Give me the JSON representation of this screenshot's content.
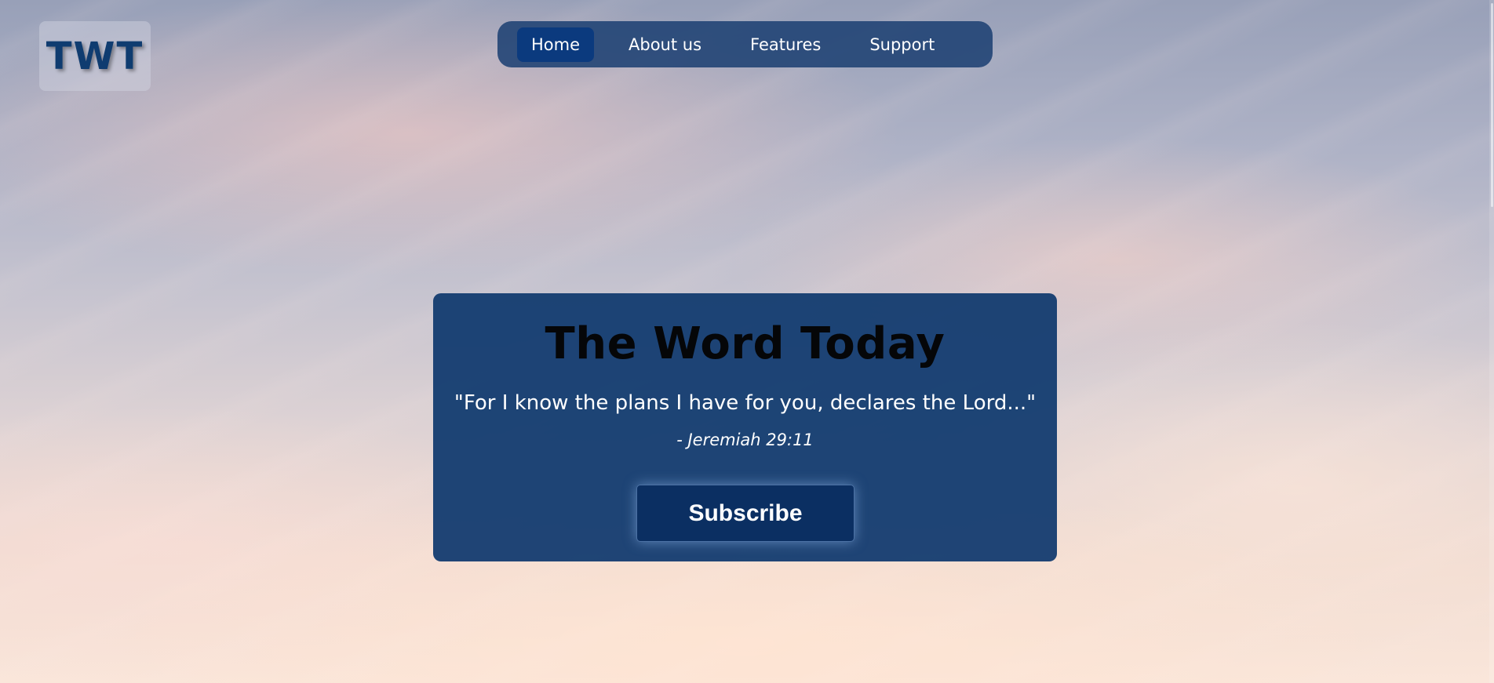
{
  "logo": {
    "text": "TWT"
  },
  "nav": {
    "items": [
      {
        "label": "Home",
        "active": true
      },
      {
        "label": "About us",
        "active": false
      },
      {
        "label": "Features",
        "active": false
      },
      {
        "label": "Support",
        "active": false
      }
    ]
  },
  "hero": {
    "title": "The Word Today",
    "verse": "\"For I know the plans I have for you, declares the Lord...\"",
    "reference": "- Jeremiah 29:11",
    "subscribe_label": "Subscribe"
  },
  "colors": {
    "nav_background": "#1e4173",
    "nav_active": "#0b3a7e",
    "card_background": "#113a6e",
    "button_background": "#0b2f62",
    "logo_text": "#0f3c70",
    "title_text": "#050608"
  }
}
